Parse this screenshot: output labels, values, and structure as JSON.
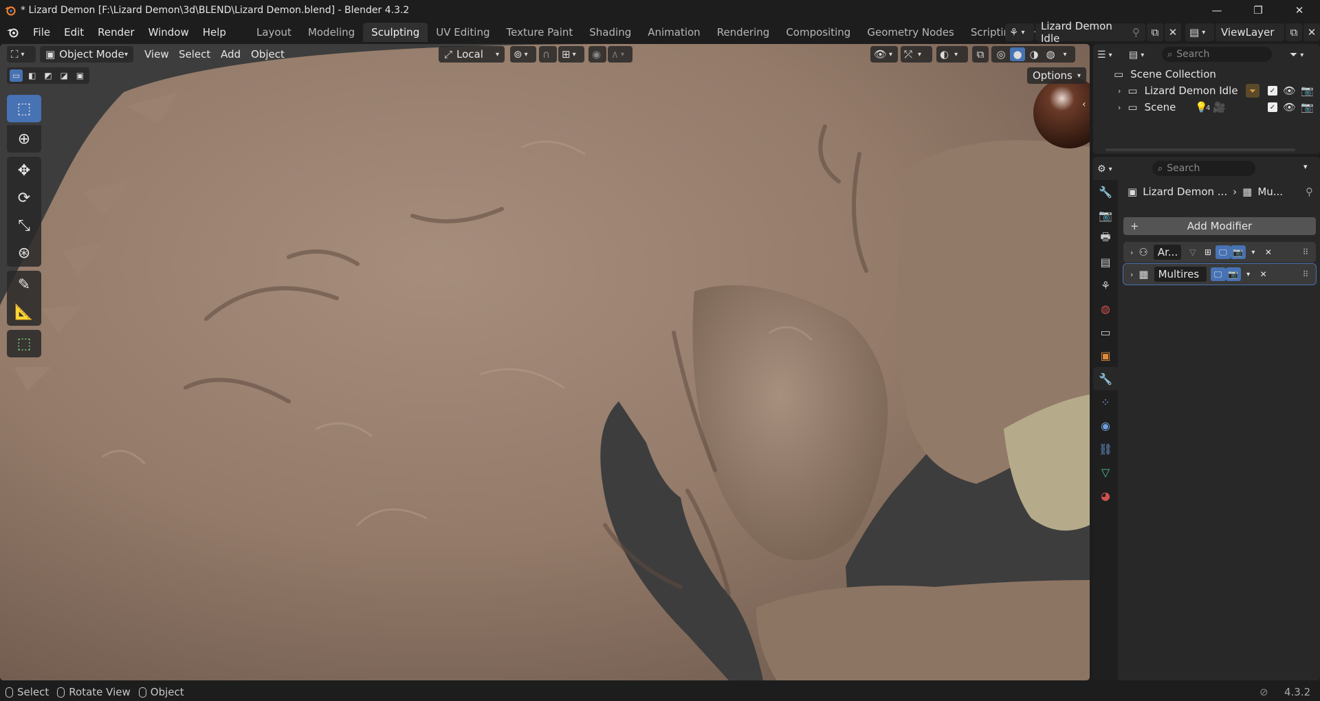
{
  "window": {
    "title": "* Lizard Demon [F:\\Lizard Demon\\3d\\BLEND\\Lizard Demon.blend] - Blender 4.3.2",
    "minimize": "—",
    "maximize": "❐",
    "close": "✕"
  },
  "menu": [
    "File",
    "Edit",
    "Render",
    "Window",
    "Help"
  ],
  "workspaces": {
    "tabs": [
      "Layout",
      "Modeling",
      "Sculpting",
      "UV Editing",
      "Texture Paint",
      "Shading",
      "Animation",
      "Rendering",
      "Compositing",
      "Geometry Nodes",
      "Scripting"
    ],
    "active": "Sculpting",
    "add": "+"
  },
  "scene_selector": {
    "value": "Lizard Demon Idle"
  },
  "view_layer": {
    "value": "ViewLayer"
  },
  "viewport": {
    "mode": "Object Mode",
    "menus": [
      "View",
      "Select",
      "Add",
      "Object"
    ],
    "transform_orientation": "Local",
    "options": "Options"
  },
  "outliner": {
    "search_placeholder": "Search",
    "root": "Scene Collection",
    "items": [
      {
        "label": "Lizard Demon Idle"
      },
      {
        "label": "Scene",
        "badge": "4"
      }
    ]
  },
  "properties": {
    "search_placeholder": "Search",
    "breadcrumb": {
      "object": "Lizard Demon ...",
      "modifier": "Mu..."
    },
    "add_modifier": "Add Modifier",
    "modifiers": [
      {
        "name": "Ar..."
      },
      {
        "name": "Multires"
      }
    ]
  },
  "statusbar": {
    "items": [
      "Select",
      "Rotate View",
      "Object"
    ],
    "version": "4.3.2"
  },
  "colors": {
    "accent": "#4772b3",
    "sculpt_base": "#9a8272",
    "viewport_bg": "#3d3d3d"
  }
}
